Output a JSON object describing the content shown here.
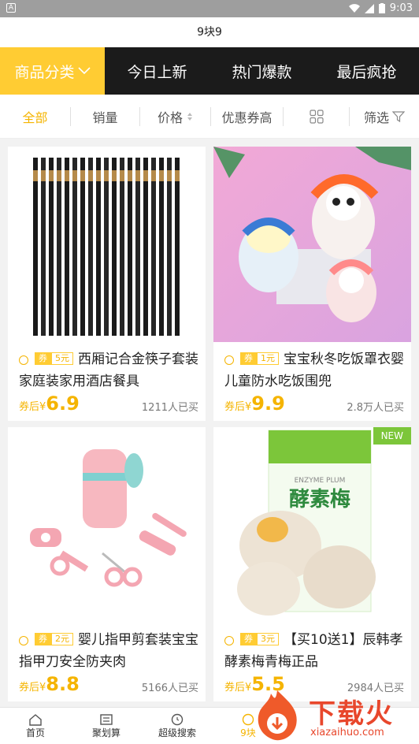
{
  "status": {
    "time": "9:03",
    "left_icon": "A"
  },
  "page_title": "9块9",
  "tabs": [
    {
      "label": "商品分类",
      "active": true
    },
    {
      "label": "今日上新"
    },
    {
      "label": "热门爆款"
    },
    {
      "label": "最后疯抢"
    }
  ],
  "sorts": [
    {
      "label": "全部",
      "active": true
    },
    {
      "label": "销量"
    },
    {
      "label": "价格"
    },
    {
      "label": "优惠券高"
    },
    {
      "label": ""
    },
    {
      "label": "筛选"
    }
  ],
  "products": [
    {
      "coupon_tag": "券",
      "coupon_value": "5元",
      "title": "西厢记合金筷子套装家庭装家用酒店餐具",
      "price_label": "券后¥",
      "price": "6.9",
      "sold": "1211人已买",
      "image": "chopsticks"
    },
    {
      "coupon_tag": "券",
      "coupon_value": "1元",
      "title": "宝宝秋冬吃饭罩衣婴儿童防水吃饭围兜",
      "price_label": "券后¥",
      "price": "9.9",
      "sold": "2.8万人已买",
      "image": "bibs"
    },
    {
      "coupon_tag": "券",
      "coupon_value": "2元",
      "title": "婴儿指甲剪套装宝宝指甲刀安全防夹肉",
      "price_label": "券后¥",
      "price": "8.8",
      "sold": "5166人已买",
      "image": "nail-kit"
    },
    {
      "coupon_tag": "券",
      "coupon_value": "3元",
      "title": "【买10送1】辰韩孝酵素梅青梅正品",
      "price_label": "券后¥",
      "price": "5.5",
      "sold": "2984人已买",
      "image": "plum",
      "badge": "NEW",
      "pack_text": "酵素梅",
      "pack_sub": "ENZYME PLUM"
    }
  ],
  "bottom_nav": [
    {
      "label": "首页",
      "icon": "home-icon"
    },
    {
      "label": "聚划算",
      "icon": "deal-icon"
    },
    {
      "label": "超级搜索",
      "icon": "search-icon"
    },
    {
      "label": "9块",
      "icon": "nine-icon"
    }
  ],
  "watermark": {
    "text": "下载火",
    "sub": "xiazaihuo.com"
  },
  "colors": {
    "accent": "#ffcc33",
    "dark_tab": "#1b1b1b",
    "price": "#f5b400",
    "new_badge": "#7cc63a"
  }
}
